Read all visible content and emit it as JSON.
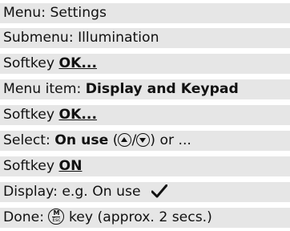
{
  "instructions": {
    "step1": {
      "label": "Menu:",
      "value": "Settings"
    },
    "step2": {
      "label": "Submenu:",
      "value": "Illumination"
    },
    "step3": {
      "label": "Softkey",
      "key": "OK..."
    },
    "step4": {
      "label": "Menu item:",
      "value": "Display and Keypad"
    },
    "step5": {
      "label": "Softkey",
      "key": "OK..."
    },
    "step6": {
      "label": "Select:",
      "value": "On use",
      "paren_open": "(",
      "slash": "/",
      "paren_close": ")",
      "suffix": "or ..."
    },
    "step7": {
      "label": "Softkey",
      "key": "ON"
    },
    "step8": {
      "label": "Display: e.g.",
      "value": "On use"
    },
    "step9": {
      "label": "Done:",
      "key_top": "M",
      "key_bottom": "Esc",
      "suffix": "key (approx. 2 secs.)"
    }
  },
  "icons": {
    "up_arrow": "up-arrow-key-icon",
    "down_arrow": "down-arrow-key-icon",
    "checkmark": "checkmark-icon",
    "menu_escape": "menu-esc-key-icon"
  }
}
